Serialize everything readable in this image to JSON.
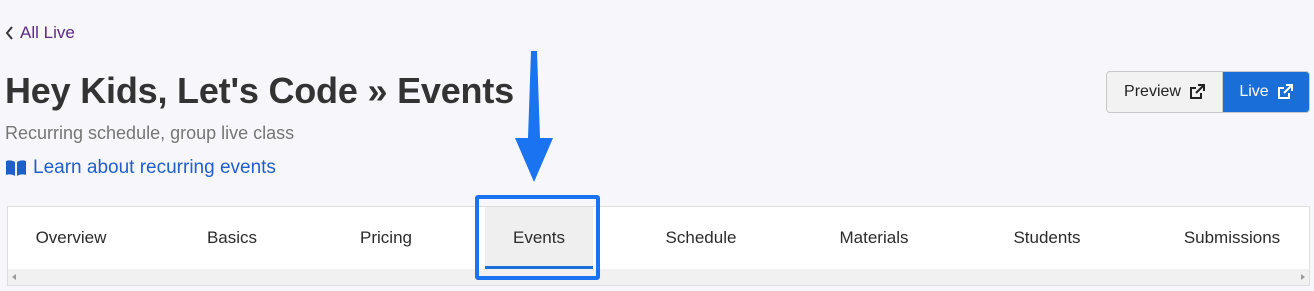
{
  "nav": {
    "back_label": "All Live",
    "back_icon": "chevron-left-icon"
  },
  "header": {
    "title": "Hey Kids, Let's Code » Events",
    "subtitle": "Recurring schedule, group live class",
    "learn_link": "Learn about recurring events",
    "learn_icon": "book-open-icon"
  },
  "actions": {
    "preview_label": "Preview",
    "live_label": "Live",
    "icon": "external-link-icon",
    "live_color": "#1a6ed8"
  },
  "tabs": [
    {
      "label": "Overview",
      "active": false
    },
    {
      "label": "Basics",
      "active": false
    },
    {
      "label": "Pricing",
      "active": false
    },
    {
      "label": "Events",
      "active": true
    },
    {
      "label": "Schedule",
      "active": false
    },
    {
      "label": "Materials",
      "active": false
    },
    {
      "label": "Students",
      "active": false
    },
    {
      "label": "Submissions",
      "active": false
    }
  ],
  "annotation": {
    "color": "#1a73f0",
    "icon": "down-arrow-icon"
  }
}
